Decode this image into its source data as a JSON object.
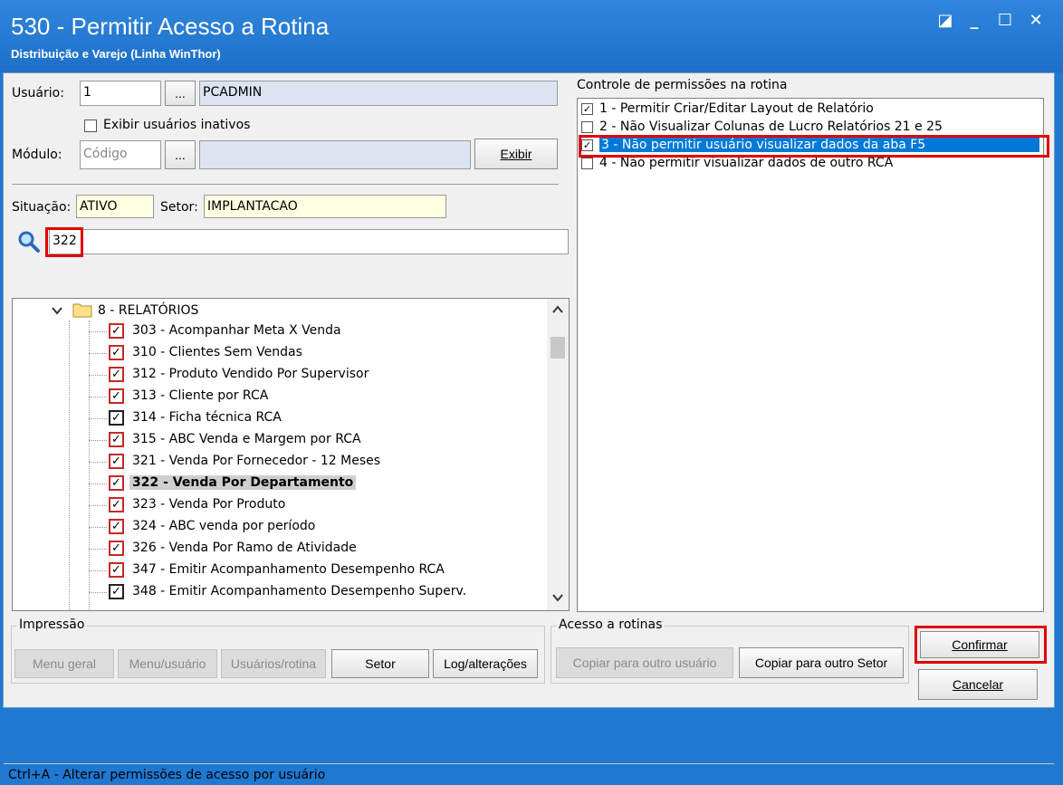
{
  "window": {
    "title": "530 - Permitir Acesso a Rotina",
    "subtitle": "Distribuição e Varejo (Linha WinThor)",
    "controls": {
      "restore": "◪",
      "minimize": "_",
      "maximize": "☐",
      "close": "✕"
    }
  },
  "user_section": {
    "usuario_label": "Usuário:",
    "usuario_code": "1",
    "usuario_name": "PCADMIN",
    "ellipsis": "...",
    "show_inactive_label": "Exibir usuários inativos",
    "modulo_label": "Módulo:",
    "modulo_placeholder": "Código",
    "exibir_label": "Exibir"
  },
  "info_section": {
    "situacao_label": "Situação:",
    "situacao_value": "ATIVO",
    "setor_label": "Setor:",
    "setor_value": "IMPLANTACAO",
    "search_value": "322"
  },
  "tree": {
    "folder_label": "8 - RELATÓRIOS",
    "items": [
      {
        "label": "303 - Acompanhar Meta X Venda",
        "style": "red"
      },
      {
        "label": "310 - Clientes Sem Vendas",
        "style": "red"
      },
      {
        "label": "312 - Produto Vendido Por Supervisor",
        "style": "red"
      },
      {
        "label": "313 - Cliente por RCA",
        "style": "red"
      },
      {
        "label": "314 - Ficha técnica RCA",
        "style": "black"
      },
      {
        "label": "315 - ABC Venda e Margem por RCA",
        "style": "red"
      },
      {
        "label": "321 - Venda Por Fornecedor - 12 Meses",
        "style": "red"
      },
      {
        "label": "322 - Venda Por Departamento",
        "style": "red"
      },
      {
        "label": "323 - Venda Por Produto",
        "style": "red"
      },
      {
        "label": "324 - ABC venda por período",
        "style": "red"
      },
      {
        "label": "326 - Venda Por Ramo de Atividade",
        "style": "red"
      },
      {
        "label": "347 - Emitir Acompanhamento Desempenho RCA",
        "style": "red"
      },
      {
        "label": "348 - Emitir Acompanhamento Desempenho Superv.",
        "style": "black"
      }
    ]
  },
  "permissions": {
    "title": "Controle de permissões na rotina",
    "items": [
      {
        "label": "1 - Permitir Criar/Editar Layout de Relatório"
      },
      {
        "label": "2 - Não Visualizar Colunas de Lucro Relatórios 21 e 25"
      },
      {
        "label": "3 - Não permitir usuário visualizar dados da aba F5"
      },
      {
        "label": "4 - Não permitir visualizar dados de outro RCA"
      }
    ]
  },
  "impressao": {
    "label": "Impressão",
    "menu_geral": "Menu geral",
    "menu_usuario": "Menu/usuário",
    "usuarios_rotina": "Usuários/rotina",
    "setor": "Setor",
    "log_alteracoes": "Log/alterações"
  },
  "acesso": {
    "label": "Acesso a rotinas",
    "copiar_usuario": "Copiar para outro usuário",
    "copiar_setor": "Copiar para outro Setor"
  },
  "actions": {
    "confirmar": "Confirmar",
    "cancelar": "Cancelar"
  },
  "statusbar": {
    "text": "Ctrl+A - Alterar permissões de acesso por usuário"
  },
  "colors": {
    "titlebar": "#1f78d1",
    "selection": "#0078d7",
    "highlight": "#e00000"
  },
  "icons": [
    "restore-icon",
    "minimize-icon",
    "maximize-icon",
    "close-icon",
    "search-icon",
    "folder-icon",
    "chevron-down-icon",
    "scroll-up-icon",
    "scroll-down-icon",
    "check-icon"
  ]
}
